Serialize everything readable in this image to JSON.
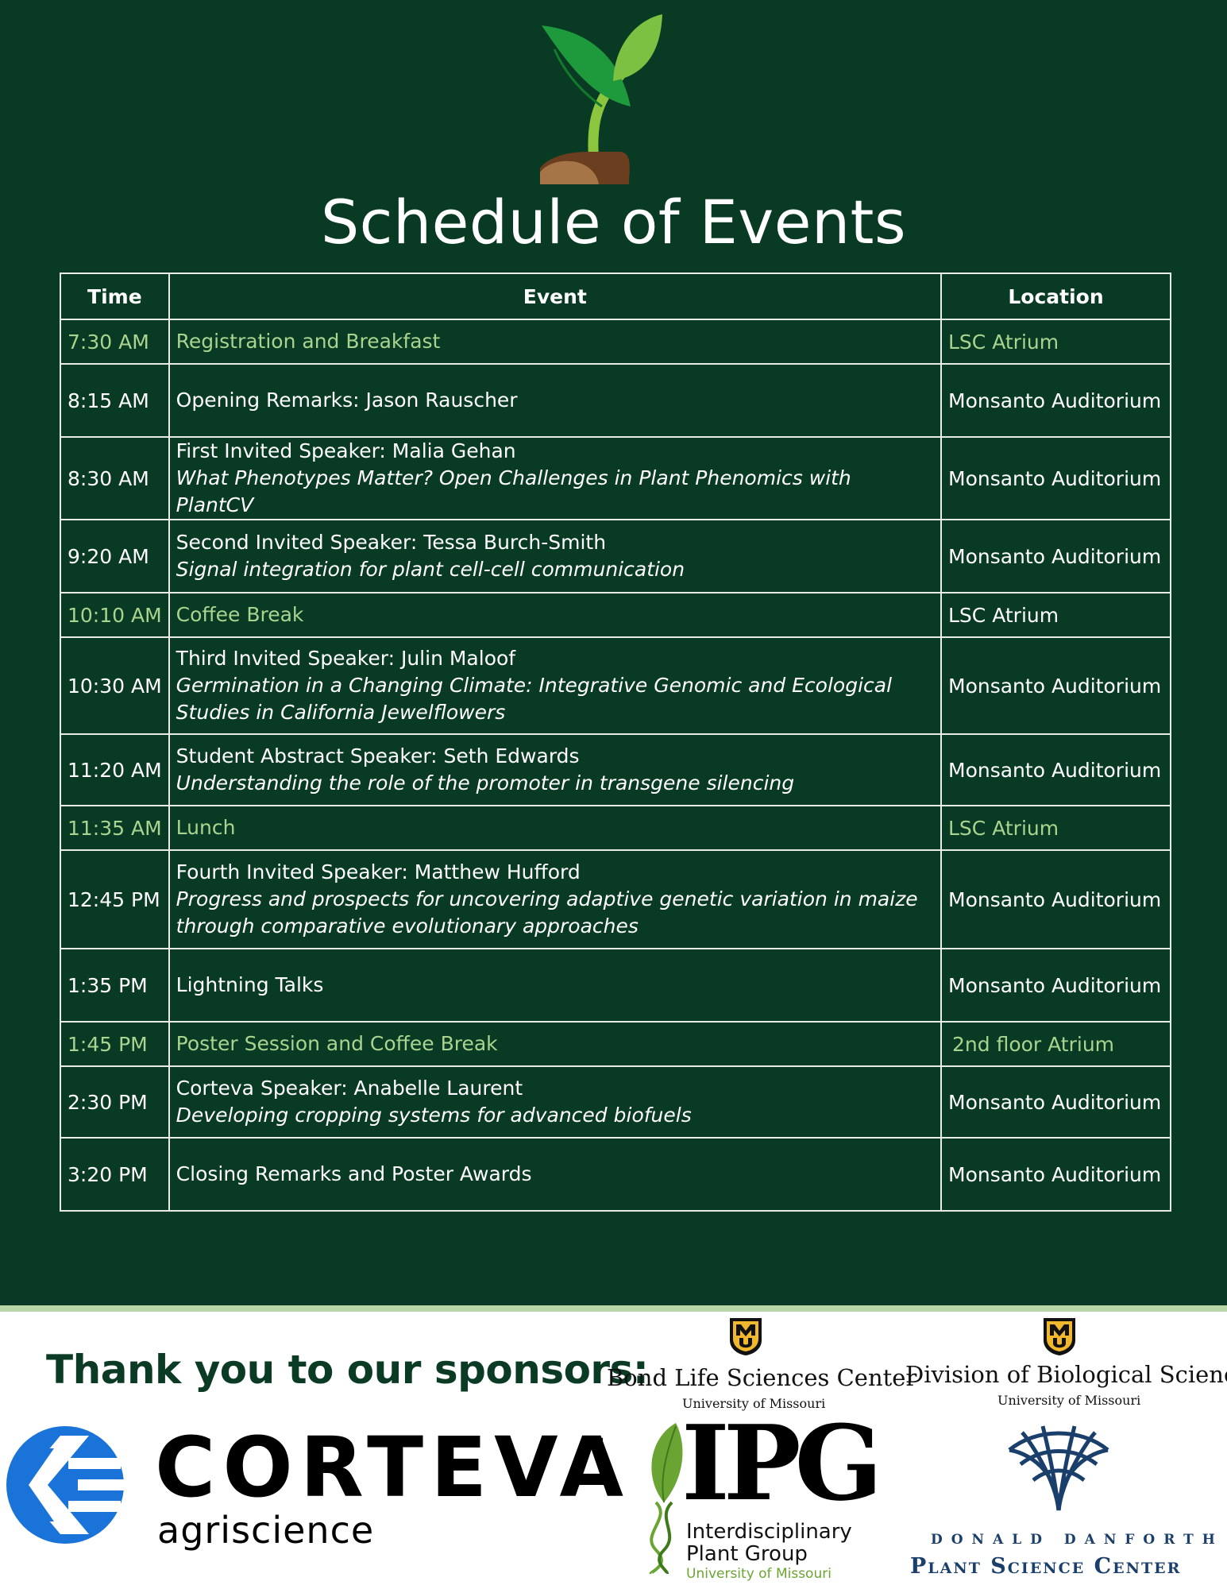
{
  "header": {
    "title": "Schedule of Events",
    "icon": "sprout-icon"
  },
  "schedule": {
    "columns": [
      "Time",
      "Event",
      "Location"
    ],
    "rows": [
      {
        "time": "7:30 AM",
        "speaker": "Registration and Breakfast",
        "talk": "",
        "location": "LSC Atrium",
        "highlight": true
      },
      {
        "time": "8:15 AM",
        "speaker": "Opening Remarks: Jason Rauscher",
        "talk": "",
        "location": "Monsanto Auditorium",
        "highlight": false
      },
      {
        "time": "8:30 AM",
        "speaker": "First Invited Speaker: Malia Gehan",
        "talk": "What Phenotypes Matter? Open Challenges in Plant Phenomics with PlantCV",
        "location": "Monsanto Auditorium",
        "highlight": false
      },
      {
        "time": "9:20 AM",
        "speaker": "Second Invited Speaker: Tessa Burch-Smith",
        "talk": "Signal integration for plant cell-cell communication",
        "location": "Monsanto Auditorium",
        "highlight": false
      },
      {
        "time": "10:10 AM",
        "speaker": "Coffee Break",
        "talk": "",
        "location": "LSC Atrium",
        "highlight": true
      },
      {
        "time": "10:30 AM",
        "speaker": "Third Invited Speaker: Julin Maloof",
        "talk": "Germination in a Changing Climate: Integrative Genomic and Ecological Studies in California Jewelflowers",
        "location": "Monsanto Auditorium",
        "highlight": false
      },
      {
        "time": "11:20 AM",
        "speaker": "Student Abstract Speaker: Seth Edwards",
        "talk": "Understanding the role of the promoter in transgene silencing",
        "location": "Monsanto Auditorium",
        "highlight": false
      },
      {
        "time": "11:35 AM",
        "speaker": "Lunch",
        "talk": "",
        "location": "LSC Atrium",
        "highlight": true
      },
      {
        "time": "12:45 PM",
        "speaker": "Fourth Invited Speaker: Matthew Hufford",
        "talk": "Progress and prospects for uncovering adaptive genetic variation in maize through comparative evolutionary approaches",
        "location": "Monsanto Auditorium",
        "highlight": false
      },
      {
        "time": "1:35 PM",
        "speaker": "Lightning Talks",
        "talk": "",
        "location": "Monsanto Auditorium",
        "highlight": false
      },
      {
        "time": "1:45 PM",
        "speaker": "Poster Session and Coffee Break",
        "talk": "",
        "location": "2nd floor Atrium",
        "highlight": true
      },
      {
        "time": "2:30 PM",
        "speaker": "Corteva Speaker: Anabelle Laurent",
        "talk": "Developing cropping systems for advanced biofuels",
        "location": "Monsanto Auditorium",
        "highlight": false
      },
      {
        "time": "3:20 PM",
        "speaker": "Closing Remarks and Poster Awards",
        "talk": "",
        "location": "Monsanto Auditorium",
        "highlight": false
      }
    ]
  },
  "sponsors": {
    "heading": "Thank you to our sponsors:",
    "bond": {
      "name": "Bond Life Sciences Center",
      "sub": "University of Missouri"
    },
    "division": {
      "name": "Division of Biological Sciences",
      "sub": "University of Missouri"
    },
    "corteva": {
      "word": "CORTEVA",
      "tm": "™",
      "sub": "agriscience"
    },
    "ipg": {
      "letters": "IPG",
      "line1": "Interdisciplinary",
      "line2": "Plant Group",
      "line3": "University of Missouri"
    },
    "danforth": {
      "line1": "DONALD DANFORTH",
      "line2": "Plant Science Center"
    }
  },
  "colors": {
    "background": "#093a23",
    "highlight_text": "#a9d490",
    "heading_green": "#0b3b24",
    "corteva_blue": "#1a73d9",
    "ipg_green": "#6aa533",
    "danforth_blue": "#1b3f6b",
    "mizzou_gold": "#f1b82d"
  }
}
